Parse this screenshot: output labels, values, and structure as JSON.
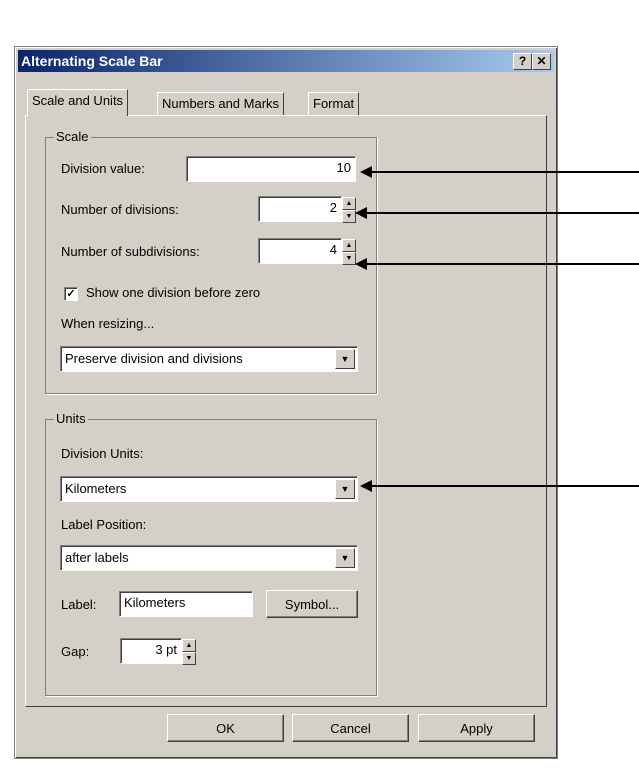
{
  "dialog": {
    "title": "Alternating Scale Bar",
    "help_label": "?",
    "close_label": "✕"
  },
  "tabs": [
    "Scale and Units",
    "Numbers and Marks",
    "Format"
  ],
  "scale_group": {
    "legend": "Scale",
    "division_value_label": "Division value:",
    "division_value": "10",
    "number_of_divisions_label": "Number of divisions:",
    "number_of_divisions": "2",
    "number_of_subdivisions_label": "Number of subdivisions:",
    "number_of_subdivisions": "4",
    "show_one_division_label": "Show one division before zero",
    "show_one_division_checked": true,
    "when_resizing_label": "When resizing...",
    "when_resizing_value": "Preserve division and divisions"
  },
  "units_group": {
    "legend": "Units",
    "division_units_label": "Division Units:",
    "division_units_value": "Kilometers",
    "label_position_label": "Label Position:",
    "label_position_value": "after labels",
    "label_label": "Label:",
    "label_value": "Kilometers",
    "symbol_button": "Symbol...",
    "gap_label": "Gap:",
    "gap_value": "3 pt"
  },
  "footer": {
    "ok": "OK",
    "cancel": "Cancel",
    "apply": "Apply"
  }
}
